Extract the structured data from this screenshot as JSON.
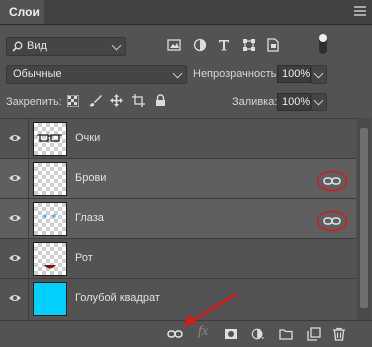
{
  "panel": {
    "tab_title": "Слои"
  },
  "filter": {
    "label": "Вид"
  },
  "blend": {
    "mode": "Обычные",
    "opacity_label": "Непрозрачность:",
    "opacity_value": "100%"
  },
  "lock": {
    "label": "Закрепить:",
    "fill_label": "Заливка:",
    "fill_value": "100%"
  },
  "layers": [
    {
      "name": "Очки",
      "selected": false,
      "linked": false
    },
    {
      "name": "Брови",
      "selected": true,
      "linked": true
    },
    {
      "name": "Глаза",
      "selected": true,
      "linked": true
    },
    {
      "name": "Рот",
      "selected": false,
      "linked": false
    },
    {
      "name": "Голубой квадрат",
      "selected": false,
      "linked": false
    }
  ],
  "colors": {
    "highlight": "#cc1f1f",
    "cyan": "#00d0ff"
  },
  "bottom_icons": [
    "link-icon",
    "fx-icon",
    "mask-icon",
    "adjustment-icon",
    "folder-icon",
    "new-layer-icon",
    "trash-icon"
  ]
}
